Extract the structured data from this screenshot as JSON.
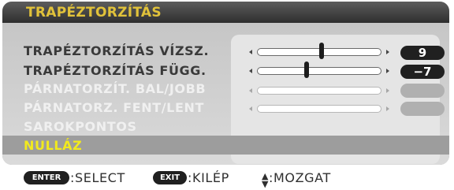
{
  "menu": {
    "title": "TRAPÉZTORZÍTÁS",
    "items": [
      {
        "label": "TRAPÉZTORZÍTÁS VÍZSZ.",
        "value": "9",
        "slider_fraction": 0.52,
        "enabled": true
      },
      {
        "label": "TRAPÉZTORZÍTÁS FÜGG.",
        "value": "−7",
        "slider_fraction": 0.4,
        "enabled": true
      },
      {
        "label": "PÁRNATORZÍT. BAL/JOBB",
        "value": "",
        "enabled": false
      },
      {
        "label": "PÁRNATORZ. FENT/LENT",
        "value": "",
        "enabled": false
      },
      {
        "label": "SAROKPONTOS",
        "enabled": false
      },
      {
        "label": "NULLÁZ",
        "selected": true
      }
    ]
  },
  "hints": {
    "enter_key": "ENTER",
    "enter_action": ":SELECT",
    "exit_key": "EXIT",
    "exit_action": ":KILÉP",
    "move_action": ":MOZGAT"
  },
  "colors": {
    "title": "#e1c23a",
    "selected_text": "#f2ea1d",
    "disabled_text": "#f0f0f0"
  },
  "icons": [
    "arrow-left-icon",
    "arrow-right-icon",
    "up-down-icon"
  ]
}
